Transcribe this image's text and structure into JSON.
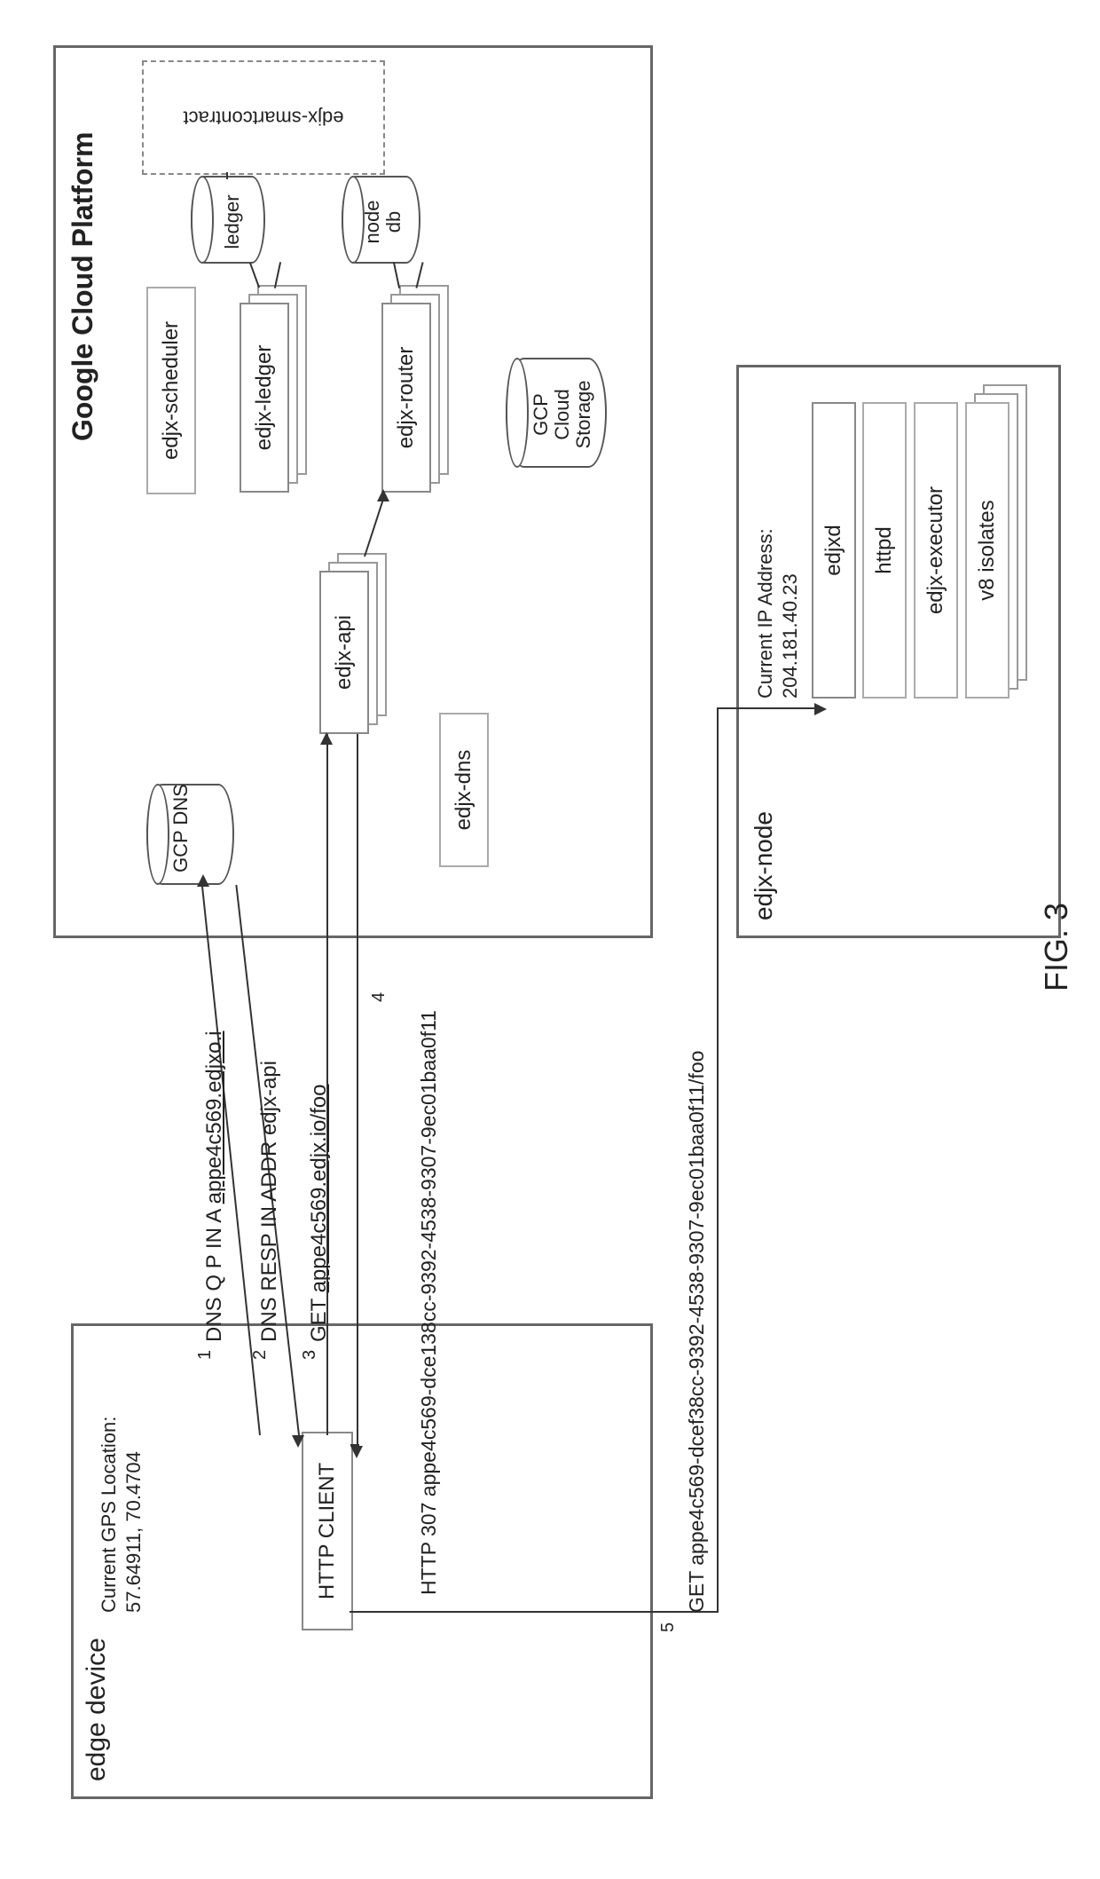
{
  "figure_label": "FIG. 3",
  "edge_device": {
    "title": "edge device",
    "gps_label": "Current GPS Location:",
    "gps_value": "57.64911, 70.4704",
    "http_client": "HTTP CLIENT"
  },
  "gcp": {
    "title": "Google Cloud Platform",
    "gcp_dns": "GCP DNS",
    "edjx_dns": "edjx-dns",
    "edjx_api": "edjx-api",
    "edjx_scheduler": "edjx-scheduler",
    "edjx_ledger": "edjx-ledger",
    "edjx_router": "edjx-router",
    "ledger_db": "ledger",
    "node_db_line1": "node",
    "node_db_line2": "db",
    "smart_contract": "edjx-smartcontract",
    "gcp_storage_line1": "GCP",
    "gcp_storage_line2": "Cloud",
    "gcp_storage_line3": "Storage"
  },
  "edjx_node": {
    "title": "edjx-node",
    "ip_label": "Current IP Address:",
    "ip_value": "204.181.40.23",
    "edjxd": "edjxd",
    "httpd": "httpd",
    "executor": "edjx-executor",
    "v8": "v8 isolates"
  },
  "flows": {
    "step1_num": "1",
    "step1_text_a": "DNS Q P IN A ",
    "step1_text_b": "appe4c569.edjxo.i",
    "step2_num": "2",
    "step2_text": "DNS RESP IN ADDR edjx-api",
    "step3_num": "3",
    "step3_text_a": "GET ",
    "step3_text_b": "appe4c569.edjx.io/foo",
    "step4_num": "4",
    "step4_text": "HTTP 307 appe4c569-dce138cc-9392-4538-9307-9ec01baa0f11",
    "step5_num": "5",
    "step5_text": "GET appe4c569-dcef38cc-9392-4538-9307-9ec01baa0f11/foo"
  }
}
